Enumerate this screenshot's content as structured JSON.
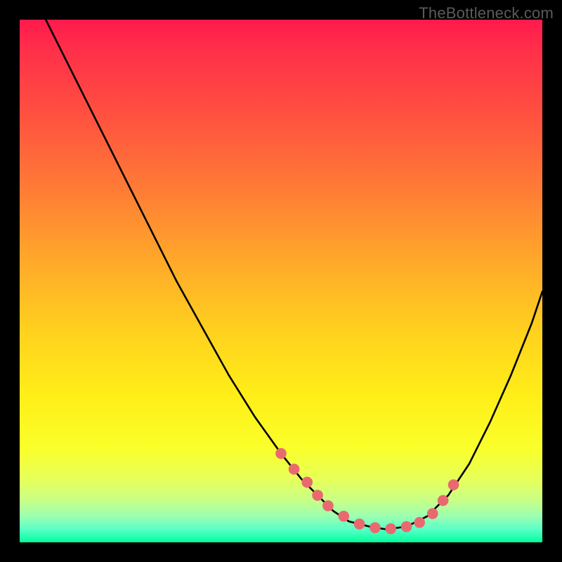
{
  "watermark": "TheBottleneck.com",
  "colors": {
    "bg": "#000000",
    "line": "#000000",
    "point": "#e86a6f"
  },
  "chart_data": {
    "type": "line",
    "title": "",
    "xlabel": "",
    "ylabel": "",
    "xlim": [
      0,
      100
    ],
    "ylim": [
      0,
      100
    ],
    "grid": false,
    "legend": false,
    "series": [
      {
        "name": "curve",
        "x": [
          5,
          10,
          15,
          20,
          25,
          30,
          35,
          40,
          45,
          50,
          54,
          57,
          60,
          63,
          67,
          70,
          74,
          78,
          82,
          86,
          90,
          94,
          98,
          100
        ],
        "y": [
          100,
          90,
          80,
          70,
          60,
          50,
          41,
          32,
          24,
          17,
          12,
          9,
          6,
          4,
          3,
          2.5,
          3,
          5,
          9,
          15,
          23,
          32,
          42,
          48
        ]
      }
    ],
    "points": {
      "name": "markers",
      "x": [
        50,
        52.5,
        55,
        57,
        59,
        62,
        65,
        68,
        71,
        74,
        76.5,
        79,
        81,
        83
      ],
      "y": [
        17,
        14,
        11.5,
        9,
        7,
        5,
        3.5,
        2.8,
        2.6,
        3,
        3.8,
        5.5,
        8,
        11
      ]
    }
  }
}
